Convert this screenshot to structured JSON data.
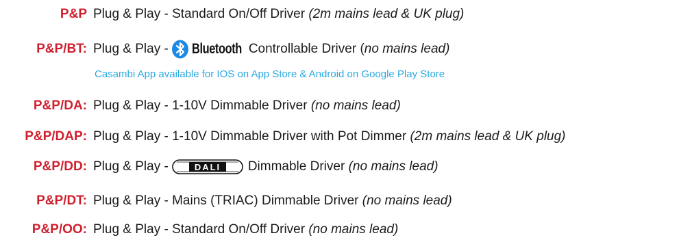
{
  "rows": [
    {
      "code": "P&P",
      "prefix": "Plug & Play - Standard On/Off Driver",
      "note": "(2m mains lead & UK plug)"
    },
    {
      "code": "P&P/BT:",
      "prefix": "Plug & Play -",
      "logo_text": "Bluetooth",
      "after_logo": "Controllable Driver (",
      "note": "no mains lead)"
    },
    {
      "code": "P&P/DA:",
      "prefix": "Plug & Play - 1-10V Dimmable Driver",
      "note": "(no mains lead)"
    },
    {
      "code": "P&P/DAP:",
      "prefix": "Plug & Play - 1-10V Dimmable Driver with Pot Dimmer",
      "note": "(2m mains lead & UK plug)"
    },
    {
      "code": "P&P/DD:",
      "prefix": "Plug & Play -",
      "logo_text": "DALI",
      "after_logo": "Dimmable Driver",
      "note": "(no mains lead)"
    },
    {
      "code": "P&P/DT:",
      "prefix": "Plug & Play - Mains (TRIAC) Dimmable Driver",
      "note": "(no mains lead)"
    },
    {
      "code": "P&P/OO:",
      "prefix": "Plug & Play - Standard On/Off Driver",
      "note": "(no mains lead)"
    }
  ],
  "bt_sub_note": "Casambi App available for IOS on App Store & Android on Google Play Store",
  "icons": {
    "bluetooth": "bluetooth-icon",
    "dali": "dali-logo-icon"
  },
  "colors": {
    "code": "#d0202f",
    "sub_note": "#2aa9e0",
    "bluetooth": "#1e88e5"
  }
}
